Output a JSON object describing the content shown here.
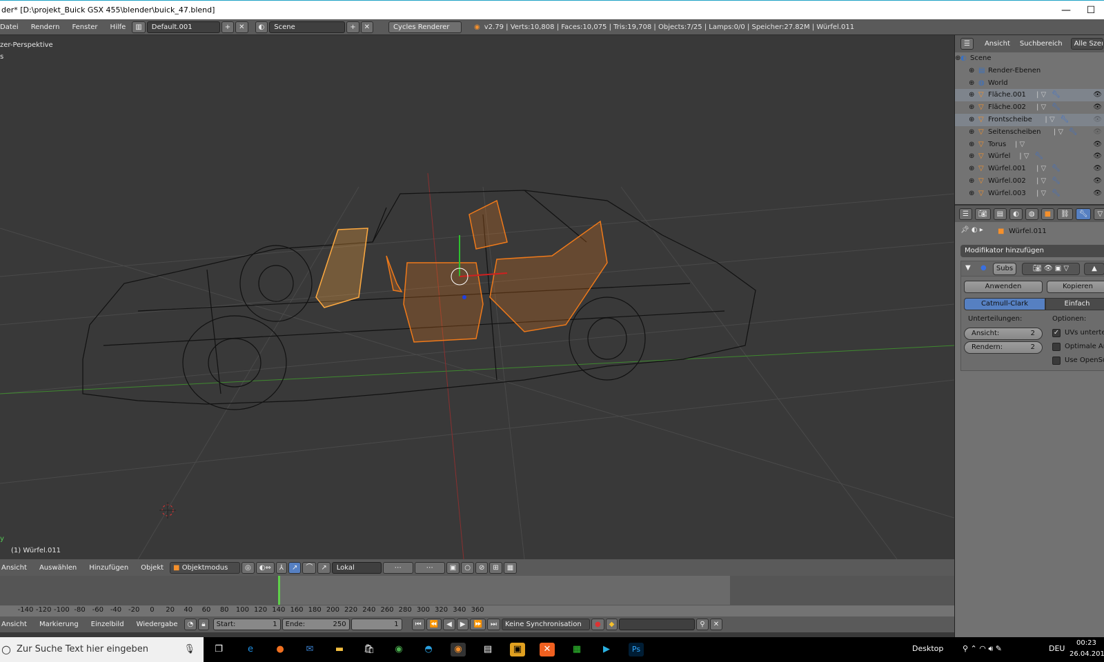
{
  "window": {
    "title": "der* [D:\\projekt_Buick GSX 455\\blender\\buick_47.blend]",
    "minimize": "—",
    "maximize": "☐"
  },
  "menubar": {
    "items": [
      "Datei",
      "Rendern",
      "Fenster",
      "Hilfe"
    ],
    "layout": "Default.001",
    "scene": "Scene",
    "renderer": "Cycles Renderer",
    "stats": "v2.79 | Verts:10,808 | Faces:10,075 | Tris:19,708 | Objects:7/25 | Lamps:0/0 | Speicher:27.82M | Würfel.011"
  },
  "viewport": {
    "view_name": "zer-Perspektive",
    "sub": "s",
    "object_label": "(1) Würfel.011",
    "axis_label": "y"
  },
  "view3d_header": {
    "menus": [
      "Ansicht",
      "Auswählen",
      "Hinzufügen",
      "Objekt"
    ],
    "mode": "Objektmodus",
    "orientation": "Lokal"
  },
  "timeline": {
    "ruler": [
      "-140",
      "-120",
      "-100",
      "-80",
      "-60",
      "-40",
      "-20",
      "0",
      "20",
      "40",
      "60",
      "80",
      "100",
      "120",
      "140",
      "160",
      "180",
      "200",
      "220",
      "240",
      "260",
      "280",
      "300",
      "320",
      "340",
      "360"
    ],
    "current_frame_position": 0,
    "menus": [
      "Ansicht",
      "Markierung",
      "Einzelbild",
      "Wiedergabe"
    ],
    "start_label": "Start:",
    "start": "1",
    "end_label": "Ende:",
    "end": "250",
    "current": "1",
    "sync": "Keine Synchronisation"
  },
  "outliner": {
    "menus": [
      "Ansicht",
      "Suchbereich"
    ],
    "filter": "Alle Szene",
    "items": [
      {
        "name": "Scene"
      },
      {
        "name": "Render-Ebenen"
      },
      {
        "name": "World"
      },
      {
        "name": "Fläche.001"
      },
      {
        "name": "Fläche.002"
      },
      {
        "name": "Frontscheibe"
      },
      {
        "name": "Seitenscheiben"
      },
      {
        "name": "Torus"
      },
      {
        "name": "Würfel"
      },
      {
        "name": "Würfel.001"
      },
      {
        "name": "Würfel.002"
      },
      {
        "name": "Würfel.003"
      }
    ]
  },
  "properties": {
    "object": "Würfel.011",
    "add_modifier": "Modifikator hinzufügen",
    "modifier_name": "Subs",
    "apply": "Anwenden",
    "copy": "Kopieren",
    "catmull": "Catmull-Clark",
    "simple": "Einfach",
    "subdivisions": "Unterteilungen:",
    "options": "Optionen:",
    "view_label": "Ansicht:",
    "view_value": "2",
    "render_label": "Rendern:",
    "render_value": "2",
    "opt1": "UVs unterteile",
    "opt1_checked": true,
    "opt2": "Optimale Anz",
    "opt2_checked": false,
    "opt3": "Use OpenSub",
    "opt3_checked": false
  },
  "taskbar": {
    "search_placeholder": "Zur Suche Text hier eingeben",
    "desktop": "Desktop",
    "lang": "DEU",
    "time": "00:23",
    "date": "26.04.2018"
  },
  "colors": {
    "selected": "#f07a1a",
    "active": "#ffaa40",
    "accent": "#5680c2"
  }
}
